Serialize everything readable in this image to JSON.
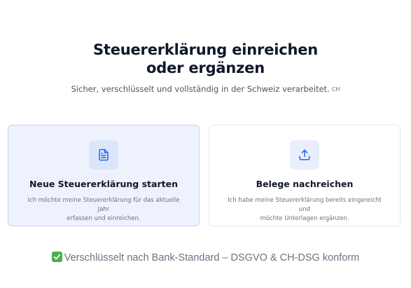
{
  "header": {
    "title_line1": "Steuererklärung einreichen",
    "title_line2": "oder ergänzen",
    "subtitle": "Sicher, verschlüsselt und vollständig in der Schweiz verarbeitet.",
    "country_code": "CH"
  },
  "options": [
    {
      "title": "Neue Steuererklärung starten",
      "desc_line1": "Ich möchte meine Steuererklärung für das aktuelle Jahr",
      "desc_line2": "erfassen und einreichen.",
      "icon": "document-icon",
      "selected": true
    },
    {
      "title": "Belege nachreichen",
      "desc_line1": "Ich habe meine Steuererklärung bereits eingereicht und",
      "desc_line2": "möchte Unterlagen ergänzen.",
      "icon": "upload-icon",
      "selected": false
    }
  ],
  "footer": {
    "text": "Verschlüsselt nach Bank-Standard – DSGVO & CH-DSG konform",
    "icon": "check-icon"
  },
  "colors": {
    "accent": "#2563eb",
    "selected_card_bg": "#eef2fd",
    "icon_box_bg": "#dbe6fd",
    "check_green": "#4caf50"
  }
}
